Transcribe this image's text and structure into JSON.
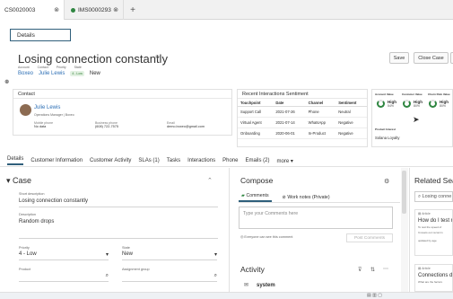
{
  "tabs": [
    {
      "label": "CS0020003",
      "close": "⊗"
    },
    {
      "label": "IMS0000293",
      "close": "⊗"
    }
  ],
  "new_tab": "+",
  "details_tab": "Details",
  "case_title": "Losing connection constantly",
  "meta": {
    "labels": [
      "Account",
      "Contact",
      "Priority",
      "State"
    ],
    "account": "Boxeo",
    "contact": "Julie Lewis",
    "priority": "4 - Low",
    "state": "New"
  },
  "header_buttons": {
    "save": "Save",
    "close_case": "Close Case"
  },
  "contact_section": {
    "title": "Contact",
    "name": "Julie Lewis",
    "role": "Operations Manager | Boxeo",
    "mobile_label": "Mobile phone",
    "mobile_value": "No data",
    "business_label": "Business phone",
    "business_value": "(608) 722-7575",
    "email_label": "Email",
    "email_value": "demo.boxeo@gmail.com"
  },
  "interactions": {
    "title": "Recent Interactions Sentiment",
    "columns": [
      "Touchpoint",
      "Date",
      "Channel",
      "Sentiment"
    ],
    "rows": [
      [
        "Support Call",
        "2021-07-26",
        "Phone",
        "Neutral"
      ],
      [
        "Virtual Agent",
        "2021-07-14",
        "WhatsApp",
        "Negative"
      ],
      [
        "Onboarding",
        "2020-06-01",
        "In-Product",
        "Negative"
      ]
    ]
  },
  "account": {
    "labels": [
      "Account Value",
      "Customer Value",
      "Churn Risk Value"
    ],
    "metrics": [
      {
        "level": "High",
        "pct": "54%"
      },
      {
        "level": "High",
        "pct": "80%"
      },
      {
        "level": "High",
        "pct": "80%"
      }
    ],
    "product_label": "Product Interest",
    "product_value": "Solana Loyalty"
  },
  "nav_tabs": [
    "Details",
    "Customer Information",
    "Customer Activity",
    "SLAs (1)",
    "Tasks",
    "Interactions",
    "Phone",
    "Emails (2)",
    "more ▾"
  ],
  "case": {
    "heading": "Case",
    "short_desc_label": "Short description",
    "short_desc_value": "Losing connection constantly",
    "desc_label": "Description",
    "desc_value": "Random drops",
    "priority_label": "Priority",
    "priority_value": "4 - Low",
    "state_label": "State",
    "state_value": "New",
    "product_label": "Product",
    "group_label": "Assignment group"
  },
  "compose": {
    "title": "Compose",
    "tab_comments": "Comments",
    "tab_notes": "Work notes (Private)",
    "placeholder": "Type your Comments here",
    "note": "Everyone can see this comment",
    "post_button": "Post Comments"
  },
  "activity": {
    "title": "Activity",
    "first_item": "system"
  },
  "related": {
    "title": "Related Sea",
    "search_value": "Losing conne",
    "cards": [
      {
        "label": "Article",
        "title": "How do I test n",
        "sub1": "To test the speed of",
        "sub2": "It resets our recomm",
        "sub3": "updated by age"
      },
      {
        "label": "Article",
        "title": "Connections d",
        "sub1": "What are the factors"
      }
    ]
  },
  "colors": {
    "accent": "#2f5f7b",
    "green": "#2e8540",
    "link": "#2d6fb5"
  }
}
